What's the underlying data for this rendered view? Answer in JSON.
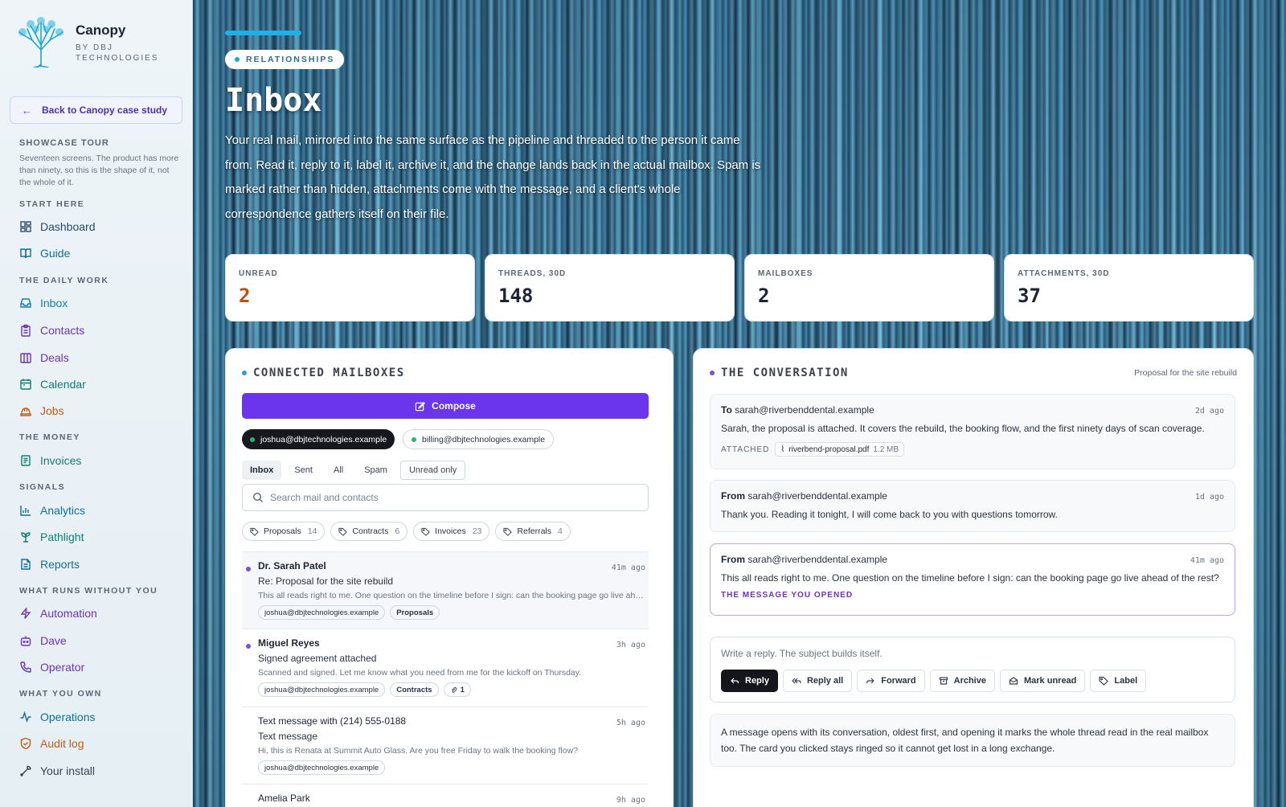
{
  "brand": {
    "name": "Canopy",
    "sub": "BY DBJ TECHNOLOGIES"
  },
  "sidebar": {
    "back_label": "Back to Canopy case study",
    "tour_heading": "SHOWCASE TOUR",
    "tour_text": "Seventeen screens. The product has more than ninety, so this is the shape of it, not the whole of it.",
    "sections": [
      {
        "title": "START HERE",
        "items": [
          {
            "label": "Dashboard",
            "icon": "dashboard-icon",
            "color": "#2b4a6a"
          },
          {
            "label": "Guide",
            "icon": "book-icon",
            "color": "#2b4a6a"
          }
        ]
      },
      {
        "title": "THE DAILY WORK",
        "items": [
          {
            "label": "Inbox",
            "icon": "inbox-icon",
            "color": "#0e7fb0"
          },
          {
            "label": "Contacts",
            "icon": "clipboard-icon",
            "color": "#6a35b8"
          },
          {
            "label": "Deals",
            "icon": "columns-icon",
            "color": "#6a35b8"
          },
          {
            "label": "Calendar",
            "icon": "calendar-icon",
            "color": "#0e7f70"
          },
          {
            "label": "Jobs",
            "icon": "hardhat-icon",
            "color": "#c25a12"
          }
        ]
      },
      {
        "title": "THE MONEY",
        "items": [
          {
            "label": "Invoices",
            "icon": "receipt-icon",
            "color": "#0e7f70"
          }
        ]
      },
      {
        "title": "SIGNALS",
        "items": [
          {
            "label": "Analytics",
            "icon": "bar-chart-icon",
            "color": "#0e6fa0"
          },
          {
            "label": "Pathlight",
            "icon": "sprout-icon",
            "color": "#0e7f70"
          },
          {
            "label": "Reports",
            "icon": "file-icon",
            "color": "#0e6fa0"
          }
        ]
      },
      {
        "title": "WHAT RUNS WITHOUT YOU",
        "items": [
          {
            "label": "Automation",
            "icon": "bolt-icon",
            "color": "#6a35b8"
          },
          {
            "label": "Dave",
            "icon": "bot-icon",
            "color": "#6a35b8"
          },
          {
            "label": "Operator",
            "icon": "phone-icon",
            "color": "#6a35b8"
          }
        ]
      },
      {
        "title": "WHAT YOU OWN",
        "items": [
          {
            "label": "Operations",
            "icon": "pulse-icon",
            "color": "#0e6fa0"
          },
          {
            "label": "Audit log",
            "icon": "shield-icon",
            "color": "#c25a12"
          },
          {
            "label": "Your install",
            "icon": "wrench-icon",
            "color": "#3a4250"
          }
        ]
      }
    ]
  },
  "hero": {
    "pill": "RELATIONSHIPS",
    "title": "Inbox",
    "lead": "Your real mail, mirrored into the same surface as the pipeline and threaded to the person it came from. Read it, reply to it, label it, archive it, and the change lands back in the actual mailbox. Spam is marked rather than hidden, attachments come with the message, and a client's whole correspondence gathers itself on their file."
  },
  "stats": [
    {
      "label": "UNREAD",
      "value": "2",
      "color": "#b8520e"
    },
    {
      "label": "THREADS, 30D",
      "value": "148",
      "color": "#1d2433"
    },
    {
      "label": "MAILBOXES",
      "value": "2",
      "color": "#1d2433"
    },
    {
      "label": "ATTACHMENTS, 30D",
      "value": "37",
      "color": "#1d2433"
    }
  ],
  "mailboxes": {
    "heading": "CONNECTED MAILBOXES",
    "compose": "Compose",
    "accounts": [
      "joshua@dbjtechnologies.example",
      "billing@dbjtechnologies.example"
    ],
    "tabs": [
      "Inbox",
      "Sent",
      "All",
      "Spam",
      "Unread only"
    ],
    "search_placeholder": "Search mail and contacts",
    "labels": [
      {
        "name": "Proposals",
        "count": "14"
      },
      {
        "name": "Contracts",
        "count": "6"
      },
      {
        "name": "Invoices",
        "count": "23"
      },
      {
        "name": "Referrals",
        "count": "4"
      }
    ],
    "threads": [
      {
        "from": "Dr. Sarah Patel",
        "time": "41m ago",
        "subject": "Re: Proposal for the site rebuild",
        "preview": "This all reads right to me. One question on the timeline before I sign: can the booking page go live ahead of the rest?",
        "tags": [
          "joshua@dbjtechnologies.example",
          "Proposals"
        ]
      },
      {
        "from": "Miguel Reyes",
        "time": "3h ago",
        "subject": "Signed agreement attached",
        "preview": "Scanned and signed. Let me know what you need from me for the kickoff on Thursday.",
        "tags": [
          "joshua@dbjtechnologies.example",
          "Contracts"
        ],
        "attachments": "1"
      },
      {
        "from": "Text message with (214) 555-0188",
        "time": "5h ago",
        "subject": "Text message",
        "preview": "Hi, this is Renata at Summit Auto Glass. Are you free Friday to walk the booking flow?",
        "tags": [
          "joshua@dbjtechnologies.example"
        ]
      },
      {
        "from": "Amelia Park",
        "time": "9h ago"
      }
    ]
  },
  "conversation": {
    "heading": "THE CONVERSATION",
    "subject": "Proposal for the site rebuild",
    "messages": [
      {
        "dir": "To",
        "addr": "sarah@riverbenddental.example",
        "time": "2d ago",
        "body": "Sarah, the proposal is attached. It covers the rebuild, the booking flow, and the first ninety days of scan coverage.",
        "attached_label": "ATTACHED",
        "file": "riverbend-proposal.pdf",
        "size": "1.2 MB"
      },
      {
        "dir": "From",
        "addr": "sarah@riverbenddental.example",
        "time": "1d ago",
        "body": "Thank you. Reading it tonight, I will come back to you with questions tomorrow."
      },
      {
        "dir": "From",
        "addr": "sarah@riverbenddental.example",
        "time": "41m ago",
        "body": "This all reads right to me. One question on the timeline before I sign: can the booking page go live ahead of the rest?",
        "note": "THE MESSAGE YOU OPENED"
      }
    ],
    "reply_placeholder": "Write a reply. The subject builds itself.",
    "actions": [
      "Reply",
      "Reply all",
      "Forward",
      "Archive",
      "Mark unread",
      "Label"
    ],
    "footnote": "A message opens with its conversation, oldest first, and opening it marks the whole thread read in the real mailbox too. The card you clicked stays ringed so it cannot get lost in a long exchange."
  }
}
